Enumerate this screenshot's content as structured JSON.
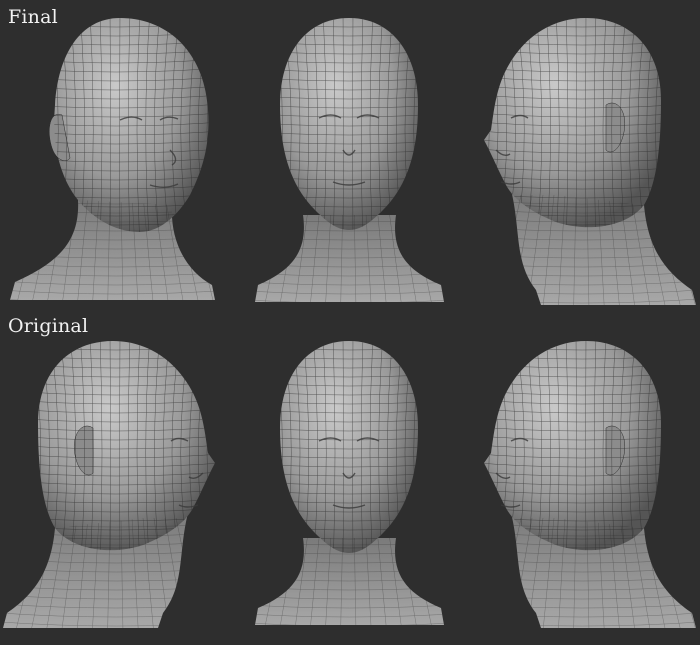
{
  "labels": {
    "top": "Final",
    "bottom": "Original"
  },
  "colors": {
    "background": "#2e2e2e",
    "skin_light": "#c9c9c9",
    "skin_mid": "#9a9a9a",
    "skin_dark": "#555555",
    "wire": "#2a2a2a",
    "label": "#f2f2f2"
  },
  "rows": [
    {
      "name": "final",
      "views": [
        "three-quarter-left",
        "front",
        "profile-left"
      ]
    },
    {
      "name": "original",
      "views": [
        "profile-right",
        "front",
        "profile-left"
      ]
    }
  ]
}
